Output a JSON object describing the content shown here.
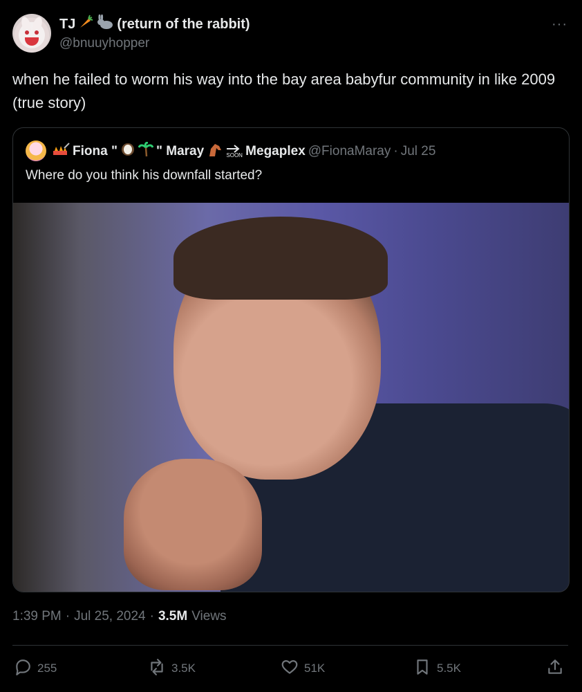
{
  "author": {
    "display_name_prefix": "TJ",
    "display_name_suffix": "(return of the rabbit)",
    "handle": "@bnuuyhopper"
  },
  "tweet": {
    "text": "when he failed to worm his way into the bay area babyfur community in like 2009 (true story)",
    "time": "1:39 PM",
    "date": "Jul 25, 2024",
    "views_count": "3.5M",
    "views_label": "Views",
    "more_glyph": "···"
  },
  "quote": {
    "name_part1": "Fiona \"",
    "name_part2": "\" Maray",
    "name_part3": "Megaplex",
    "handle": "@FionaMaray",
    "date": "Jul 25",
    "text": "Where do you think his downfall started?",
    "soon_label": "SOON"
  },
  "actions": {
    "replies": "255",
    "reposts": "3.5K",
    "likes": "51K",
    "bookmarks": "5.5K"
  },
  "colors": {
    "background": "#000000",
    "text_primary": "#e7e9ea",
    "text_secondary": "#71767b",
    "border": "#2f3336"
  },
  "icons": [
    "carrot-icon",
    "rabbit-icon",
    "coconut-icon",
    "palm-tree-icon",
    "horse-icon",
    "soon-arrow-icon",
    "reply-icon",
    "repost-icon",
    "like-icon",
    "bookmark-icon",
    "share-icon"
  ]
}
